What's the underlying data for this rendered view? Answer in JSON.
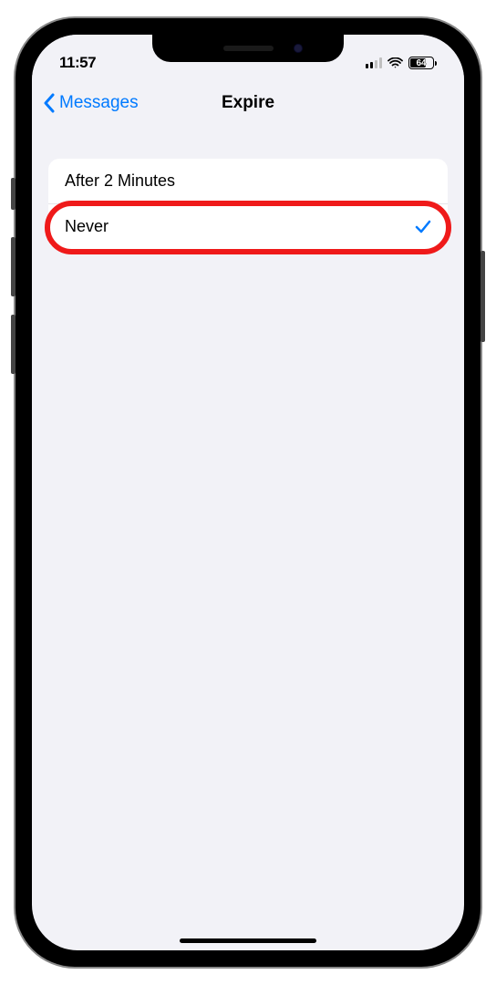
{
  "statusBar": {
    "time": "11:57",
    "batteryLevel": "64"
  },
  "navBar": {
    "backLabel": "Messages",
    "title": "Expire"
  },
  "options": [
    {
      "label": "After 2 Minutes",
      "selected": false,
      "highlighted": false
    },
    {
      "label": "Never",
      "selected": true,
      "highlighted": true
    }
  ]
}
